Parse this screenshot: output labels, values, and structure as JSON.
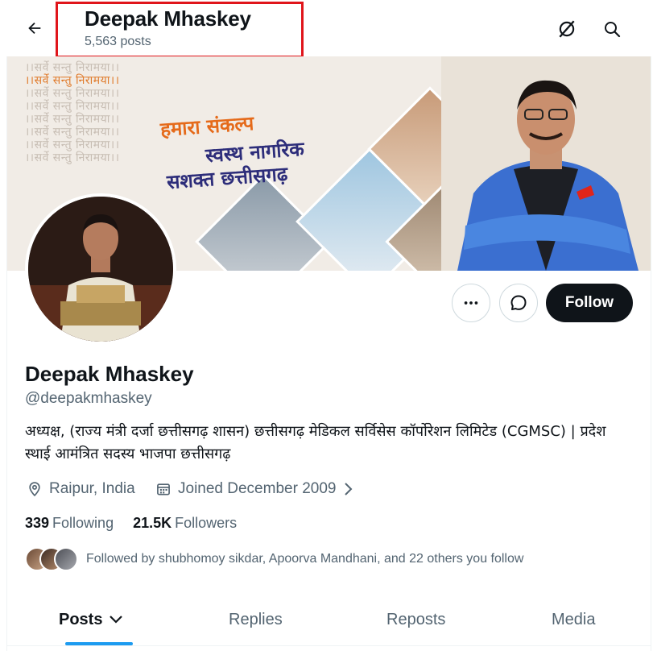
{
  "header": {
    "name": "Deepak Mhaskey",
    "posts_count": "5,563 posts",
    "back_icon": "arrow-left-icon",
    "grok_icon": "grok-icon",
    "search_icon": "search-icon"
  },
  "banner": {
    "motto": "।।सर्वे सन्तु निरामया।।",
    "slogan_line1": "हमारा संकल्प",
    "slogan_line2": "स्वस्थ नागरिक",
    "slogan_line3": "सशक्त छत्तीसगढ़"
  },
  "actions": {
    "more_icon": "more-icon",
    "message_icon": "message-icon",
    "follow_label": "Follow"
  },
  "profile": {
    "name": "Deepak Mhaskey",
    "handle": "@deepakmhaskey",
    "bio": "अध्यक्ष, (राज्य मंत्री दर्जा छत्तीसगढ़ शासन) छत्तीसगढ़ मेडिकल सर्विसेस कॉर्पोरेशन लिमिटेड (CGMSC) | प्रदेश स्थाई आमंत्रित सदस्य भाजपा छत्तीसगढ़",
    "location": "Raipur, India",
    "joined": "Joined December 2009",
    "following_count": "339",
    "following_label": "Following",
    "followers_count": "21.5K",
    "followers_label": "Followers",
    "followed_by": "Followed by shubhomoy sikdar, Apoorva Mandhani, and 22 others you follow"
  },
  "tabs": [
    {
      "label": "Posts",
      "active": true
    },
    {
      "label": "Replies",
      "active": false
    },
    {
      "label": "Reposts",
      "active": false
    },
    {
      "label": "Media",
      "active": false
    }
  ],
  "colors": {
    "accent": "#1d9bf0",
    "highlight_box": "#e0151b",
    "follow_button": "#0f1419"
  }
}
